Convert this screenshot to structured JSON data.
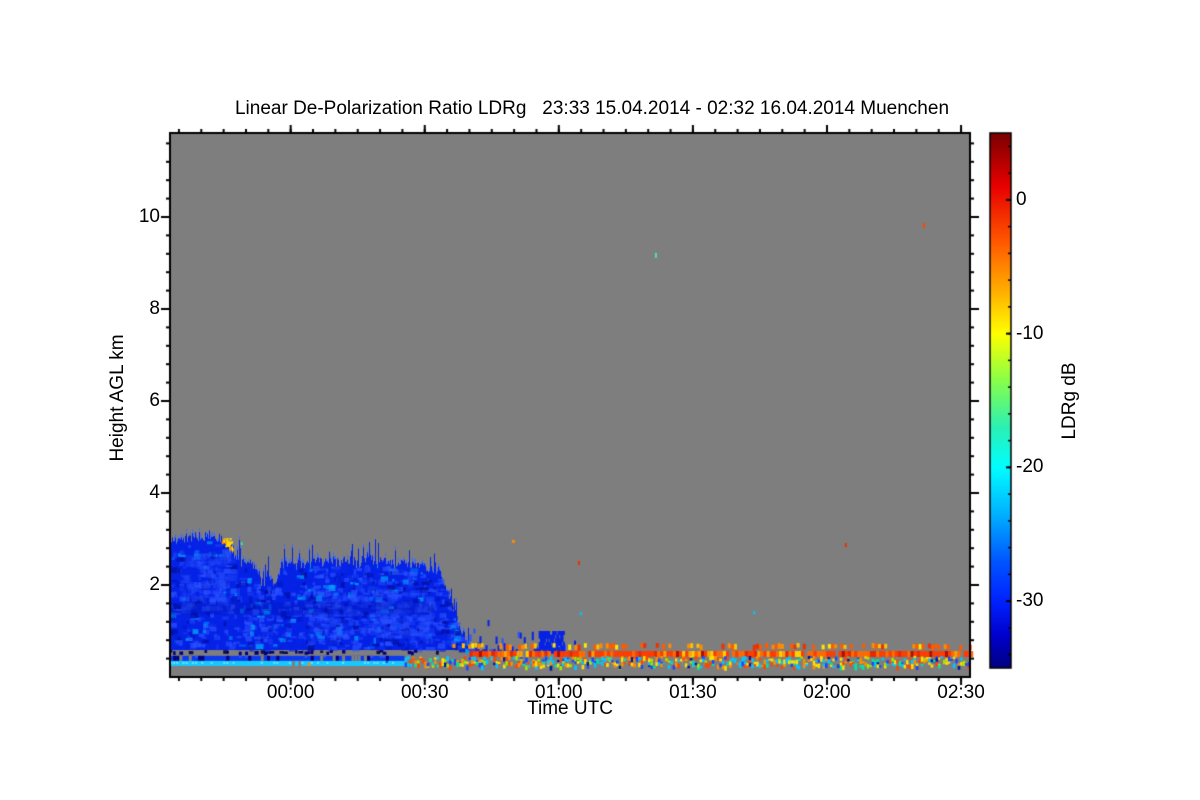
{
  "title": "Linear De-Polarization Ratio LDRg   23:33 15.04.2014 - 02:32 16.04.2014 Muenchen",
  "chart_data": {
    "type": "heatmap",
    "title": "Linear De-Polarization Ratio LDRg",
    "time_start": "23:33 15.04.2014",
    "time_end": "02:32 16.04.2014",
    "station": "Muenchen",
    "xlabel": "Time UTC",
    "ylabel": "Height AGL km",
    "x_span_minutes": 179,
    "x_tick_labels": [
      "00:00",
      "00:30",
      "01:00",
      "01:30",
      "02:00",
      "02:30"
    ],
    "x_tick_minutes_from_start": [
      27,
      57,
      87,
      117,
      147,
      177
    ],
    "x_minor_tick_every_min": 5,
    "x_minor_tick_offset_min": 2,
    "y_range_km": [
      0,
      11.83
    ],
    "y_tick_km": [
      2,
      4,
      6,
      8,
      10
    ],
    "y_tick_labels": [
      "2",
      "4",
      "6",
      "8",
      "10"
    ],
    "y_minor_tick_every_km": 0.4,
    "colorbar": {
      "label": "LDRg dB",
      "tick_labels": [
        "0",
        "-10",
        "-20",
        "-30"
      ],
      "ticks_db": [
        0,
        -10,
        -20,
        -30
      ],
      "range_db_top_to_bottom": [
        5,
        -35
      ],
      "colormap": "jet-reversed-vertical"
    },
    "nodata_color": "#7E7E7E",
    "features": {
      "cloud": {
        "description": "Low stratus cloud with LDR around -32 to -25 dB (blue) from record start 23:33 until about 00:40, tops 2.0-3.1 km, base ~0.63 km, dissolving into fragments 0.6-1.3 km until ~01:06",
        "top_profile_min_km": [
          [
            0,
            3.0
          ],
          [
            3,
            3.02
          ],
          [
            6,
            3.04
          ],
          [
            9,
            3.08
          ],
          [
            11,
            3.02
          ],
          [
            12,
            2.96
          ],
          [
            13,
            2.78
          ],
          [
            14,
            2.62
          ],
          [
            15,
            2.55
          ],
          [
            16,
            2.48
          ],
          [
            17,
            2.52
          ],
          [
            18,
            2.44
          ],
          [
            19,
            2.35
          ],
          [
            20,
            2.12
          ],
          [
            21,
            2.02
          ],
          [
            22,
            2.28
          ],
          [
            23,
            2.06
          ],
          [
            24,
            2.2
          ],
          [
            25,
            2.44
          ],
          [
            26,
            2.52
          ],
          [
            27,
            2.46
          ],
          [
            28,
            2.4
          ],
          [
            29,
            2.5
          ],
          [
            30,
            2.44
          ],
          [
            32,
            2.56
          ],
          [
            34,
            2.46
          ],
          [
            36,
            2.54
          ],
          [
            38,
            2.44
          ],
          [
            40,
            2.56
          ],
          [
            42,
            2.46
          ],
          [
            44,
            2.62
          ],
          [
            46,
            2.5
          ],
          [
            48,
            2.58
          ],
          [
            50,
            2.44
          ],
          [
            52,
            2.52
          ],
          [
            54,
            2.46
          ],
          [
            56,
            2.4
          ],
          [
            58,
            2.34
          ],
          [
            60,
            2.28
          ],
          [
            61,
            2.12
          ],
          [
            62,
            1.88
          ],
          [
            63,
            1.58
          ],
          [
            64,
            1.22
          ],
          [
            65,
            0.98
          ],
          [
            66,
            0.85
          ],
          [
            67,
            0.74
          ]
        ],
        "base_km": 0.63,
        "solid_end_min": 67,
        "fragments_min": [
          67,
          93
        ],
        "fragment_height_km": [
          0.58,
          1.35
        ],
        "blob_min": [
          82.5,
          88
        ],
        "blob_height_km": [
          0.6,
          1.05
        ],
        "yellow_patch": {
          "t_min": [
            11.5,
            13.8
          ],
          "km": [
            2.8,
            3.04
          ]
        },
        "texture_light_regions": [
          [
            2,
            14,
            1.5,
            2.7
          ],
          [
            30,
            50,
            0.9,
            2.0
          ],
          [
            45,
            58,
            0.9,
            1.9
          ]
        ],
        "dark_layer": {
          "t_min": [
            0,
            58
          ],
          "km": [
            1.35,
            1.62
          ]
        }
      },
      "surface_stripes": [
        {
          "name": "upper-orange-speckle",
          "km": [
            0.61,
            0.74
          ],
          "t_min": [
            62.5,
            179
          ],
          "style": "speckled orange/yellow/red, ~60% coverage"
        },
        {
          "name": "navy-dashes-on-gray",
          "km": [
            0.5,
            0.59
          ],
          "t_min": [
            0,
            60
          ],
          "style": "sporadic dark navy dashes"
        },
        {
          "name": "continuous-orange-red",
          "km": [
            0.435,
            0.565
          ],
          "t_min": [
            67,
            179
          ],
          "style": "nearly continuous orange-red with yellow flecks"
        },
        {
          "name": "blue-row-left",
          "km": [
            0.35,
            0.46
          ],
          "t_min": [
            0,
            52.5
          ],
          "style": "blue with occasional gray gaps"
        },
        {
          "name": "cyan-row-left",
          "km": [
            0.24,
            0.35
          ],
          "t_min": [
            0,
            52.5
          ],
          "style": "bright cyan, gaps and orange dashes near 23:52-00:03"
        },
        {
          "name": "multicolor-speckle",
          "km": [
            0.24,
            0.46
          ],
          "t_min": [
            52.5,
            179
          ],
          "style": "dense cyan/yellow/orange/blue/green speckle"
        }
      ],
      "isolated_specks": [
        {
          "t_min": 108.5,
          "km": 9.22,
          "w": 2,
          "h": 5,
          "color": "#50E890"
        },
        {
          "t_min": 168.5,
          "km": 9.87,
          "w": 2,
          "h": 5,
          "color": "#FF4600"
        },
        {
          "t_min": 76.5,
          "km": 2.98,
          "w": 3,
          "h": 3,
          "color": "#FF8C00"
        },
        {
          "t_min": 91.3,
          "km": 2.52,
          "w": 2,
          "h": 4,
          "color": "#EE3000"
        },
        {
          "t_min": 151.0,
          "km": 2.91,
          "w": 2,
          "h": 4,
          "color": "#EE3000"
        },
        {
          "t_min": 130.5,
          "km": 1.43,
          "w": 2,
          "h": 3,
          "color": "#00C8FF"
        },
        {
          "t_min": 91.7,
          "km": 1.41,
          "w": 2,
          "h": 3,
          "color": "#00C8FF"
        },
        {
          "t_min": 15.8,
          "km": 2.93,
          "w": 2,
          "h": 3,
          "color": "#37E6A0"
        }
      ],
      "colors": {
        "nodata": "#7E7E7E",
        "cloud_base": "#0522E6",
        "cloud_light": "#2A52FF",
        "cloud_dark": "#000D9E",
        "cloud_cyan": "#00AAFF",
        "cloud_top_speckle": "#3E6CFF",
        "yellow_patch": "#FFDC00",
        "orange_accent": "#FF8C00",
        "stripeA": [
          "#FF5A00",
          "#FF8C00",
          "#FFC300",
          "#EE3000",
          "#FFE800"
        ],
        "stripeB": [
          "#FF3C00",
          "#FF6A00",
          "#E82800",
          "#FFA000",
          "#B01000",
          "#FFD000"
        ],
        "multi": [
          "#00C8FF",
          "#FFE000",
          "#FF8C00",
          "#1E46FF",
          "#FF4600",
          "#00E6A0",
          "#A0E800",
          "#7E7E7E",
          "#001AA0"
        ],
        "cyan_row": "#17C8FF",
        "cyan_row_light": "#6CE4FF",
        "blue_row": "#0D39F0",
        "navy": "#000078"
      }
    }
  }
}
